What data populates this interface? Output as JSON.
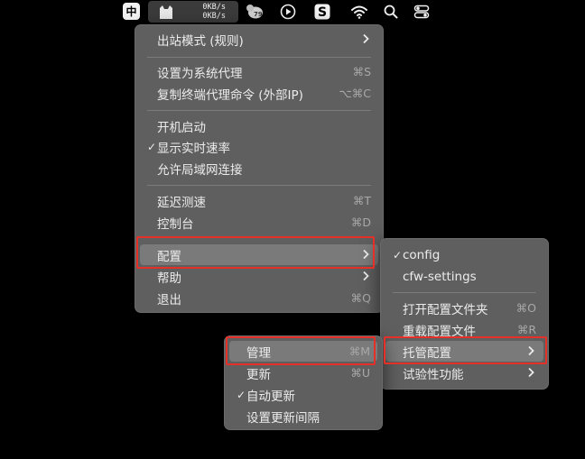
{
  "menubar": {
    "ime": "中",
    "net_up": "0KB/s",
    "net_down": "0KB/s",
    "icons": [
      "clashx-cat-icon",
      "lingo-bubble-icon",
      "play-circle-icon",
      "sogou-s-icon",
      "wifi-icon",
      "search-icon",
      "control-center-icon"
    ]
  },
  "main_menu": {
    "items": [
      {
        "label": "出站模式 (规则)",
        "shortcut": "",
        "check": "",
        "arrow": true
      },
      {
        "label": "设置为系统代理",
        "shortcut": "⌘S",
        "check": "",
        "arrow": false
      },
      {
        "label": "复制终端代理命令 (外部IP)",
        "shortcut": "⌥⌘C",
        "check": "",
        "arrow": false
      },
      {
        "label": "开机启动",
        "shortcut": "",
        "check": "",
        "arrow": false
      },
      {
        "label": "显示实时速率",
        "shortcut": "",
        "check": "✓",
        "arrow": false
      },
      {
        "label": "允许局域网连接",
        "shortcut": "",
        "check": "",
        "arrow": false
      },
      {
        "label": "延迟测速",
        "shortcut": "⌘T",
        "check": "",
        "arrow": false
      },
      {
        "label": "控制台",
        "shortcut": "⌘D",
        "check": "",
        "arrow": false
      },
      {
        "label": "配置",
        "shortcut": "",
        "check": "",
        "arrow": true
      },
      {
        "label": "帮助",
        "shortcut": "",
        "check": "",
        "arrow": true
      },
      {
        "label": "退出",
        "shortcut": "⌘Q",
        "check": "",
        "arrow": false
      }
    ]
  },
  "config_menu": {
    "items": [
      {
        "label": "config",
        "shortcut": "",
        "check": "✓",
        "arrow": false
      },
      {
        "label": "cfw-settings",
        "shortcut": "",
        "check": "",
        "arrow": false
      },
      {
        "label": "打开配置文件夹",
        "shortcut": "⌘O",
        "check": "",
        "arrow": false
      },
      {
        "label": "重载配置文件",
        "shortcut": "⌘R",
        "check": "",
        "arrow": false
      },
      {
        "label": "托管配置",
        "shortcut": "",
        "check": "",
        "arrow": true
      },
      {
        "label": "试验性功能",
        "shortcut": "",
        "check": "",
        "arrow": true
      }
    ]
  },
  "managed_menu": {
    "items": [
      {
        "label": "管理",
        "shortcut": "⌘M",
        "check": "",
        "arrow": false
      },
      {
        "label": "更新",
        "shortcut": "⌘U",
        "check": "",
        "arrow": false
      },
      {
        "label": "自动更新",
        "shortcut": "",
        "check": "✓",
        "arrow": false
      },
      {
        "label": "设置更新间隔",
        "shortcut": "",
        "check": "",
        "arrow": false
      }
    ]
  },
  "colors": {
    "menu_bg": "#5f5f5f",
    "highlight_row": "#7a7a7a",
    "annotation_red": "#e5302a"
  }
}
